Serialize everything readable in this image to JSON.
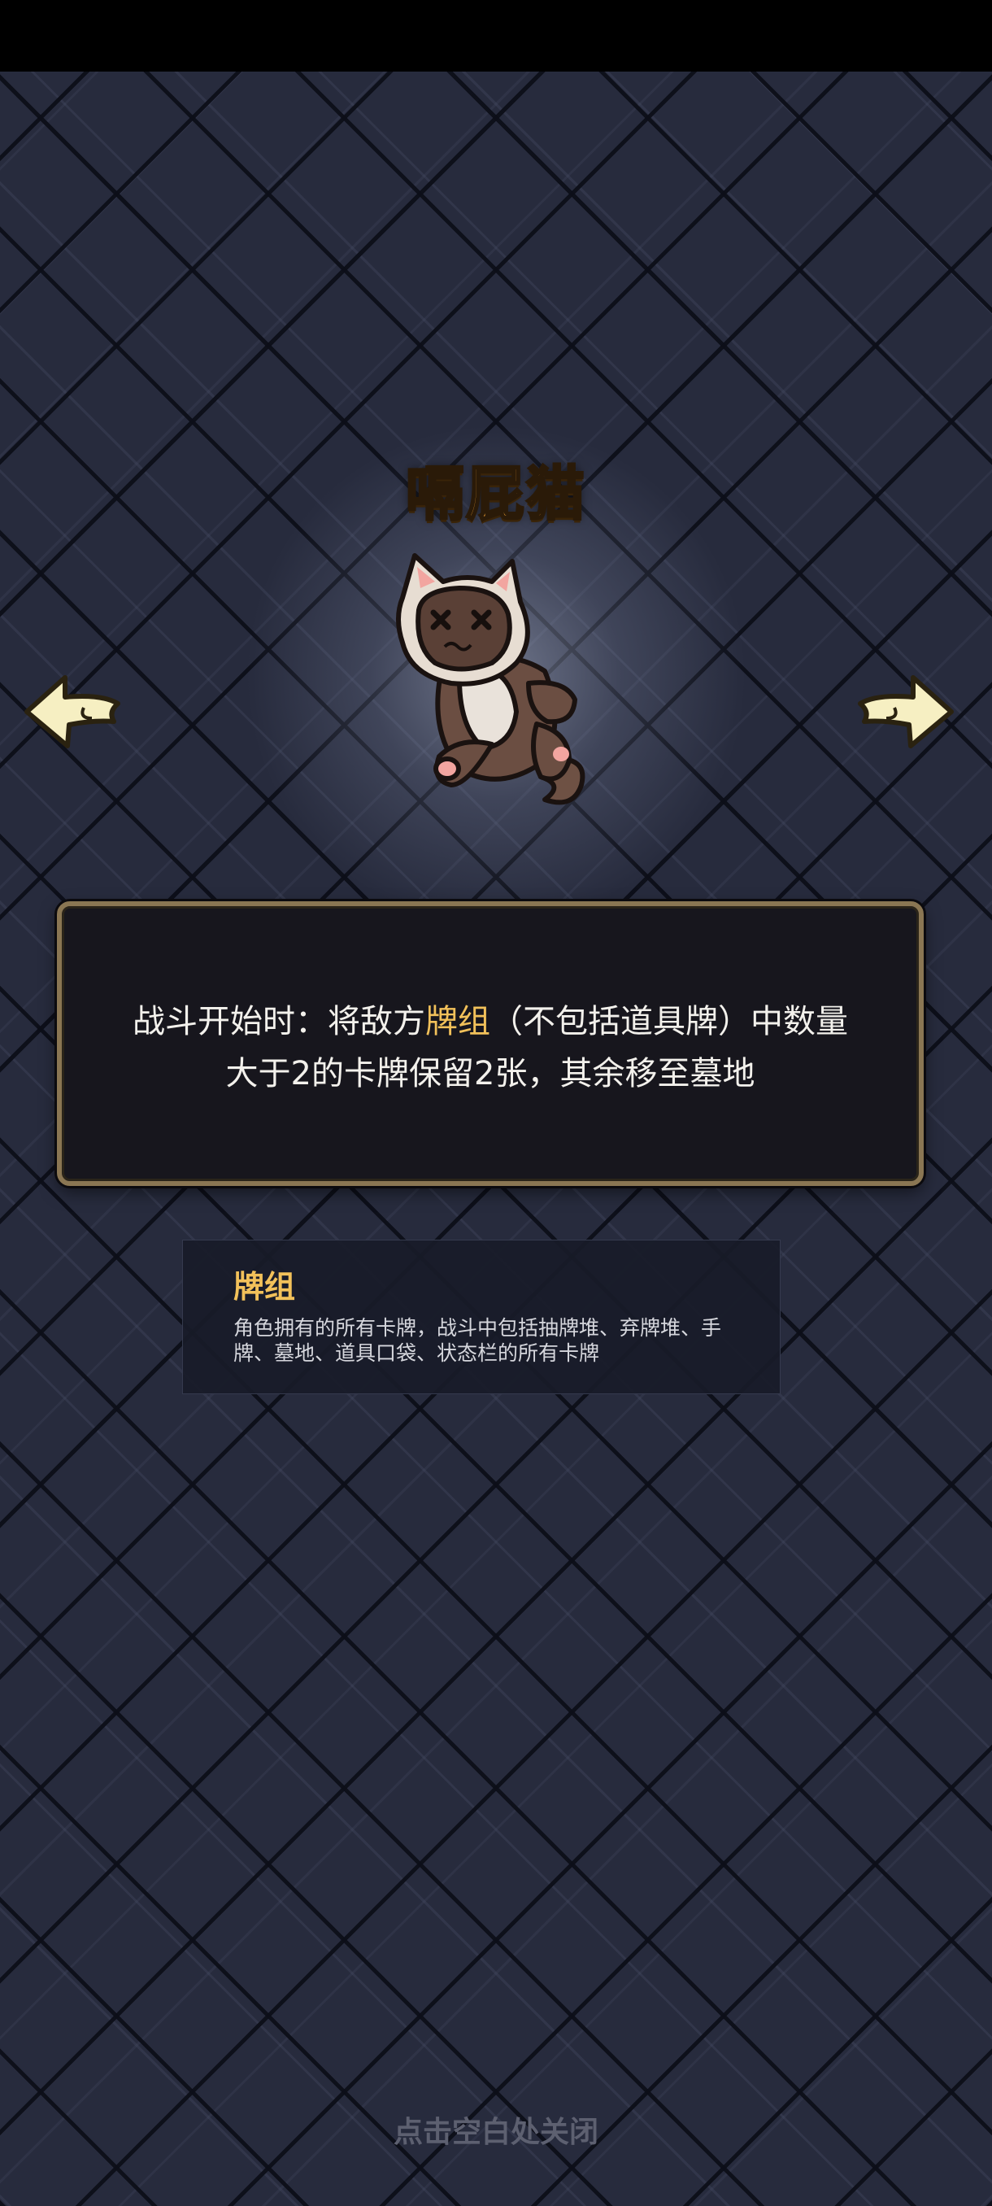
{
  "item": {
    "name": "嗝屁猫",
    "description_parts": [
      "战斗开始时：将敌方",
      "牌组",
      "（不包括道具牌）中数量",
      "大于2的卡牌保留2张，其余移至墓地"
    ]
  },
  "tooltip": {
    "title": "牌组",
    "body": "角色拥有的所有卡牌，战斗中包括抽牌堆、弃牌堆、手牌、墓地、道具口袋、状态栏的所有卡牌"
  },
  "footer": {
    "close_hint": "点击空白处关闭"
  },
  "icons": {
    "prev": "arrow-left-icon",
    "next": "arrow-right-icon",
    "item_image": "dead-cat-plush"
  },
  "colors": {
    "title": "#f4a436",
    "keyword": "#f2c15a",
    "frame": "#8a7653"
  }
}
